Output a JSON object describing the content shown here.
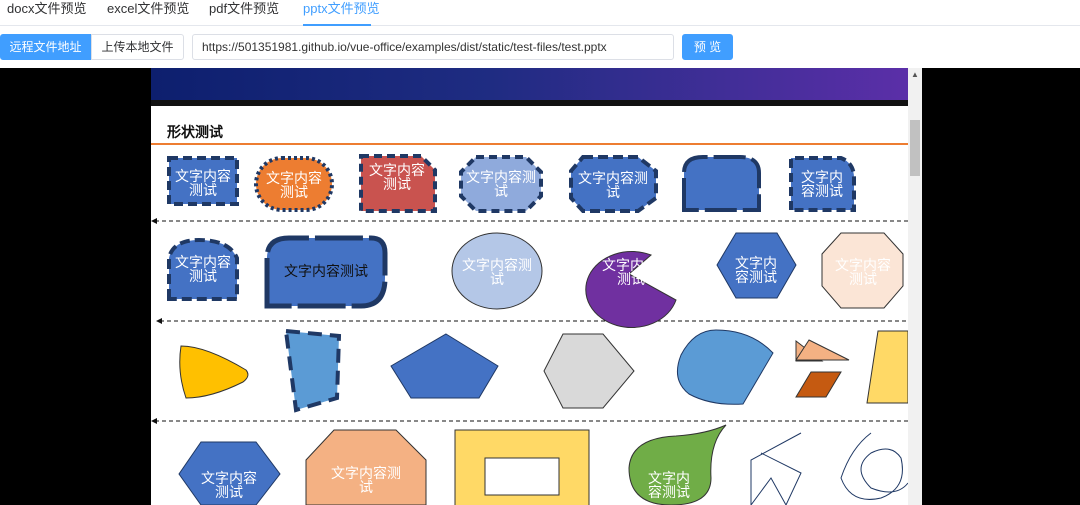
{
  "tabs": [
    {
      "label": "docx文件预览"
    },
    {
      "label": "excel文件预览"
    },
    {
      "label": "pdf文件预览"
    },
    {
      "label": "pptx文件预览"
    }
  ],
  "active_tab": 3,
  "toolbar": {
    "remote_label": "远程文件地址",
    "upload_label": "上传本地文件",
    "url_value": "https://501351981.github.io/vue-office/examples/dist/static/test-files/test.pptx",
    "preview_label": "预 览"
  },
  "slide": {
    "title": "形状测试",
    "shape_text": "文字内容测试",
    "shape_text_short": "文字内容测试"
  },
  "colors": {
    "accent": "#409eff",
    "blue": "#4472c4",
    "orange": "#ed7d31",
    "title_rule": "#ed7d31",
    "dark_border": "#1f3864"
  }
}
